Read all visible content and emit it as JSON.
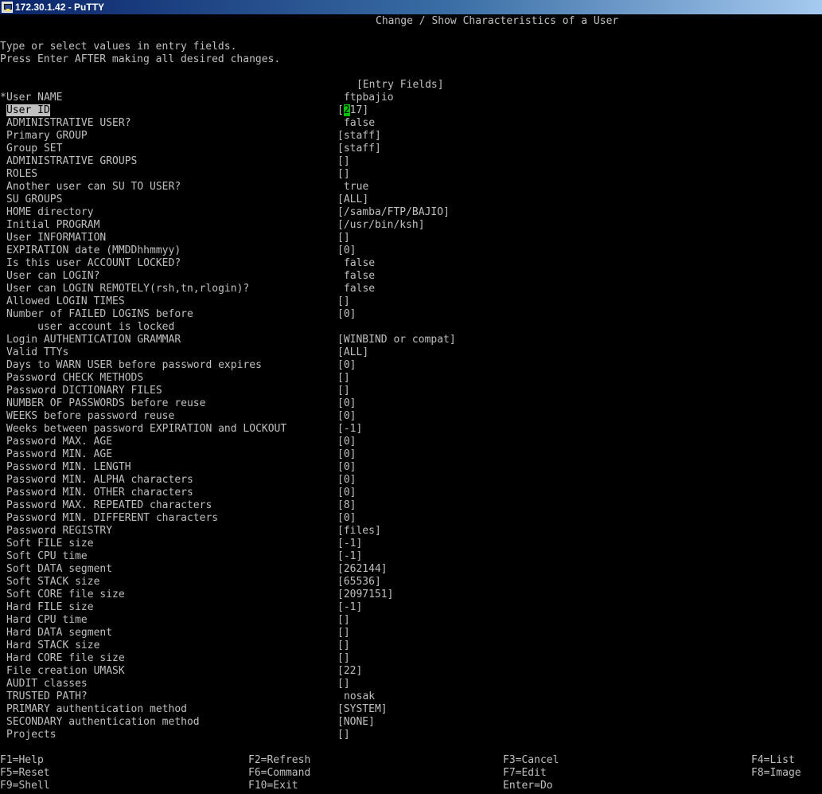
{
  "window": {
    "title": "172.30.1.42 - PuTTY",
    "app_icon": "putty-icon"
  },
  "screen": {
    "title": "Change / Show Characteristics of a User",
    "instructions": [
      "Type or select values in entry fields.",
      "Press Enter AFTER making all desired changes."
    ],
    "entry_fields_header": "[Entry Fields]"
  },
  "fields": [
    {
      "marker": "*",
      "label": "User NAME",
      "value": "ftpbajio",
      "bracketed": false
    },
    {
      "marker": "",
      "label": "User ID",
      "value": "217",
      "bracketed": true,
      "selected": true
    },
    {
      "marker": "",
      "label": "ADMINISTRATIVE USER?",
      "value": "false",
      "bracketed": false
    },
    {
      "marker": "",
      "label": "Primary GROUP",
      "value": "staff",
      "bracketed": true
    },
    {
      "marker": "",
      "label": "Group SET",
      "value": "staff",
      "bracketed": true
    },
    {
      "marker": "",
      "label": "ADMINISTRATIVE GROUPS",
      "value": "",
      "bracketed": true
    },
    {
      "marker": "",
      "label": "ROLES",
      "value": "",
      "bracketed": true
    },
    {
      "marker": "",
      "label": "Another user can SU TO USER?",
      "value": "true",
      "bracketed": false
    },
    {
      "marker": "",
      "label": "SU GROUPS",
      "value": "ALL",
      "bracketed": true
    },
    {
      "marker": "",
      "label": "HOME directory",
      "value": "/samba/FTP/BAJIO",
      "bracketed": true
    },
    {
      "marker": "",
      "label": "Initial PROGRAM",
      "value": "/usr/bin/ksh",
      "bracketed": true
    },
    {
      "marker": "",
      "label": "User INFORMATION",
      "value": "",
      "bracketed": true
    },
    {
      "marker": "",
      "label": "EXPIRATION date (MMDDhhmmyy)",
      "value": "0",
      "bracketed": true
    },
    {
      "marker": "",
      "label": "Is this user ACCOUNT LOCKED?",
      "value": "false",
      "bracketed": false
    },
    {
      "marker": "",
      "label": "User can LOGIN?",
      "value": "false",
      "bracketed": false
    },
    {
      "marker": "",
      "label": "User can LOGIN REMOTELY(rsh,tn,rlogin)?",
      "value": "false",
      "bracketed": false
    },
    {
      "marker": "",
      "label": "Allowed LOGIN TIMES",
      "value": "",
      "bracketed": true
    },
    {
      "marker": "",
      "label": "Number of FAILED LOGINS before",
      "label2": "     user account is locked",
      "value": "0",
      "bracketed": true
    },
    {
      "marker": "",
      "label": "Login AUTHENTICATION GRAMMAR",
      "value": "WINBIND or compat",
      "bracketed": true
    },
    {
      "marker": "",
      "label": "Valid TTYs",
      "value": "ALL",
      "bracketed": true
    },
    {
      "marker": "",
      "label": "Days to WARN USER before password expires",
      "value": "0",
      "bracketed": true
    },
    {
      "marker": "",
      "label": "Password CHECK METHODS",
      "value": "",
      "bracketed": true
    },
    {
      "marker": "",
      "label": "Password DICTIONARY FILES",
      "value": "",
      "bracketed": true
    },
    {
      "marker": "",
      "label": "NUMBER OF PASSWORDS before reuse",
      "value": "0",
      "bracketed": true
    },
    {
      "marker": "",
      "label": "WEEKS before password reuse",
      "value": "0",
      "bracketed": true
    },
    {
      "marker": "",
      "label": "Weeks between password EXPIRATION and LOCKOUT",
      "value": "-1",
      "bracketed": true
    },
    {
      "marker": "",
      "label": "Password MAX. AGE",
      "value": "0",
      "bracketed": true
    },
    {
      "marker": "",
      "label": "Password MIN. AGE",
      "value": "0",
      "bracketed": true
    },
    {
      "marker": "",
      "label": "Password MIN. LENGTH",
      "value": "0",
      "bracketed": true
    },
    {
      "marker": "",
      "label": "Password MIN. ALPHA characters",
      "value": "0",
      "bracketed": true
    },
    {
      "marker": "",
      "label": "Password MIN. OTHER characters",
      "value": "0",
      "bracketed": true
    },
    {
      "marker": "",
      "label": "Password MAX. REPEATED characters",
      "value": "8",
      "bracketed": true
    },
    {
      "marker": "",
      "label": "Password MIN. DIFFERENT characters",
      "value": "0",
      "bracketed": true
    },
    {
      "marker": "",
      "label": "Password REGISTRY",
      "value": "files",
      "bracketed": true
    },
    {
      "marker": "",
      "label": "Soft FILE size",
      "value": "-1",
      "bracketed": true
    },
    {
      "marker": "",
      "label": "Soft CPU time",
      "value": "-1",
      "bracketed": true
    },
    {
      "marker": "",
      "label": "Soft DATA segment",
      "value": "262144",
      "bracketed": true
    },
    {
      "marker": "",
      "label": "Soft STACK size",
      "value": "65536",
      "bracketed": true
    },
    {
      "marker": "",
      "label": "Soft CORE file size",
      "value": "2097151",
      "bracketed": true
    },
    {
      "marker": "",
      "label": "Hard FILE size",
      "value": "-1",
      "bracketed": true
    },
    {
      "marker": "",
      "label": "Hard CPU time",
      "value": "",
      "bracketed": true
    },
    {
      "marker": "",
      "label": "Hard DATA segment",
      "value": "",
      "bracketed": true
    },
    {
      "marker": "",
      "label": "Hard STACK size",
      "value": "",
      "bracketed": true
    },
    {
      "marker": "",
      "label": "Hard CORE file size",
      "value": "",
      "bracketed": true
    },
    {
      "marker": "",
      "label": "File creation UMASK",
      "value": "22",
      "bracketed": true
    },
    {
      "marker": "",
      "label": "AUDIT classes",
      "value": "",
      "bracketed": true
    },
    {
      "marker": "",
      "label": "TRUSTED PATH?",
      "value": "nosak",
      "bracketed": false
    },
    {
      "marker": "",
      "label": "PRIMARY authentication method",
      "value": "SYSTEM",
      "bracketed": true
    },
    {
      "marker": "",
      "label": "SECONDARY authentication method",
      "value": "NONE",
      "bracketed": true
    },
    {
      "marker": "",
      "label": "Projects",
      "value": "",
      "bracketed": true
    }
  ],
  "function_keys": [
    {
      "key": "F1",
      "label": "F1=Help"
    },
    {
      "key": "F2",
      "label": "F2=Refresh"
    },
    {
      "key": "F3",
      "label": "F3=Cancel"
    },
    {
      "key": "F4",
      "label": "F4=List"
    },
    {
      "key": "F5",
      "label": "F5=Reset"
    },
    {
      "key": "F6",
      "label": "F6=Command"
    },
    {
      "key": "F7",
      "label": "F7=Edit"
    },
    {
      "key": "F8",
      "label": "F8=Image"
    },
    {
      "key": "F9",
      "label": "F9=Shell"
    },
    {
      "key": "F10",
      "label": "F10=Exit"
    },
    {
      "key": "Enter",
      "label": "Enter=Do"
    }
  ],
  "colors": {
    "background": "#000000",
    "text": "#c0c0c0",
    "cursor": "#00c000",
    "titlebar_start": "#0a246a",
    "titlebar_end": "#a6caf0"
  }
}
